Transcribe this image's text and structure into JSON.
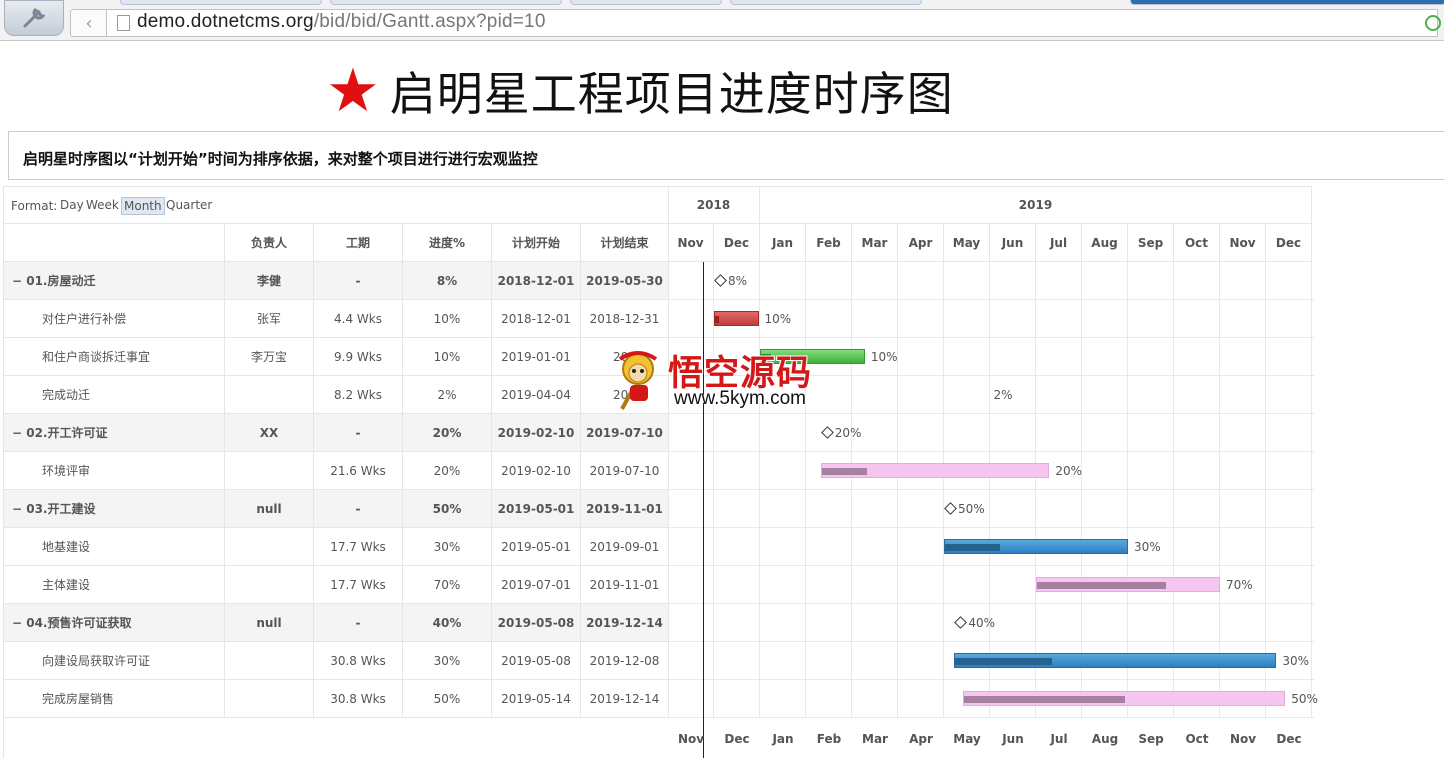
{
  "browser": {
    "url_host": "demo.dotnetcms.org",
    "url_path": "/bid/bid/Gantt.aspx?pid=10",
    "back_icon": "chevron-left-icon"
  },
  "page": {
    "title": "启明星工程项目进度时序图",
    "title_icon": "star-icon",
    "title_icon_color": "#e01010",
    "description": "启明星时序图以“计划开始”时间为排序依据，来对整个项目进行进行宏观监控"
  },
  "format": {
    "label": "Format:",
    "options": [
      "Day",
      "Week",
      "Month",
      "Quarter"
    ],
    "selected": "Month"
  },
  "columns": {
    "name": "",
    "owner": "负责人",
    "duration": "工期",
    "progress": "进度%",
    "start": "计划开始",
    "end": "计划结束"
  },
  "timeline": {
    "years": [
      "2018",
      "2019"
    ],
    "months": [
      "Nov",
      "Dec",
      "Jan",
      "Feb",
      "Mar",
      "Apr",
      "May",
      "Jun",
      "Jul",
      "Aug",
      "Sep",
      "Oct",
      "Nov",
      "Dec"
    ]
  },
  "rows": [
    {
      "type": "group",
      "toggle": "−",
      "name": "01.房屋动迁",
      "owner": "李健",
      "duration": "-",
      "progress": "8%",
      "start": "2018-12-01",
      "end": "2019-05-30",
      "bar_label": "8%"
    },
    {
      "type": "task",
      "name": "对住户进行补偿",
      "owner": "张军",
      "duration": "4.4 Wks",
      "progress": "10%",
      "start": "2018-12-01",
      "end": "2018-12-31",
      "bar_label": "10%",
      "color": "red"
    },
    {
      "type": "task",
      "name": "和住户商谈拆迁事宜",
      "owner": "李万宝",
      "duration": "9.9 Wks",
      "progress": "10%",
      "start": "2019-01-01",
      "end": "201",
      "bar_label": "10%",
      "color": "green"
    },
    {
      "type": "task",
      "name": "完成动迁",
      "owner": "",
      "duration": "8.2 Wks",
      "progress": "2%",
      "start": "2019-04-04",
      "end": "201",
      "bar_label": "2%",
      "color": "none"
    },
    {
      "type": "group",
      "toggle": "−",
      "name": "02.开工许可证",
      "owner": "XX",
      "duration": "-",
      "progress": "20%",
      "start": "2019-02-10",
      "end": "2019-07-10",
      "bar_label": "20%"
    },
    {
      "type": "task",
      "name": "环境评审",
      "owner": "",
      "duration": "21.6 Wks",
      "progress": "20%",
      "start": "2019-02-10",
      "end": "2019-07-10",
      "bar_label": "20%",
      "color": "pink"
    },
    {
      "type": "group",
      "toggle": "−",
      "name": "03.开工建设",
      "owner": "null",
      "duration": "-",
      "progress": "50%",
      "start": "2019-05-01",
      "end": "2019-11-01",
      "bar_label": "50%"
    },
    {
      "type": "task",
      "name": "地基建设",
      "owner": "",
      "duration": "17.7 Wks",
      "progress": "30%",
      "start": "2019-05-01",
      "end": "2019-09-01",
      "bar_label": "30%",
      "color": "blue"
    },
    {
      "type": "task",
      "name": "主体建设",
      "owner": "",
      "duration": "17.7 Wks",
      "progress": "70%",
      "start": "2019-07-01",
      "end": "2019-11-01",
      "bar_label": "70%",
      "color": "pink"
    },
    {
      "type": "group",
      "toggle": "−",
      "name": "04.预售许可证获取",
      "owner": "null",
      "duration": "-",
      "progress": "40%",
      "start": "2019-05-08",
      "end": "2019-12-14",
      "bar_label": "40%"
    },
    {
      "type": "task",
      "name": "向建设局获取许可证",
      "owner": "",
      "duration": "30.8 Wks",
      "progress": "30%",
      "start": "2019-05-08",
      "end": "2019-12-08",
      "bar_label": "30%",
      "color": "blue"
    },
    {
      "type": "task",
      "name": "完成房屋销售",
      "owner": "",
      "duration": "30.8 Wks",
      "progress": "50%",
      "start": "2019-05-14",
      "end": "2019-12-14",
      "bar_label": "50%",
      "color": "pink"
    }
  ],
  "watermark": {
    "text": "悟空源码",
    "url": "www.5kym.com"
  }
}
